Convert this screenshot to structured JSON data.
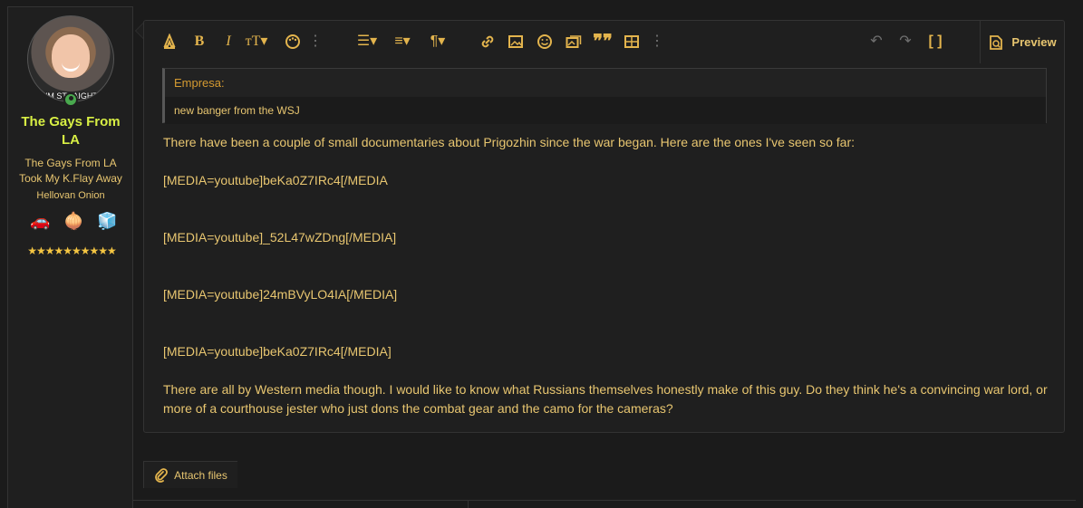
{
  "user": {
    "name": "The Gays From LA",
    "title": "The Gays From LA Took My K.Flay Away",
    "role": "Hellovan Onion",
    "avatar_caption": "I'M STRAIGHT",
    "trophies": [
      "onion-car-icon",
      "onion-icon",
      "cube-icon"
    ],
    "stars": "★★★★★★★★★★"
  },
  "editor": {
    "toolbar": {
      "items": [
        "format-icon",
        "bold-icon",
        "italic-icon",
        "text-size-icon",
        "palette-icon",
        "more-icon",
        "list-icon",
        "align-icon",
        "paragraph-icon",
        "link-icon",
        "image-icon",
        "smilie-icon",
        "media-icon",
        "quote-icon",
        "table-icon",
        "more-icon",
        "undo-icon",
        "redo-icon",
        "fullscreen-icon"
      ],
      "preview_label": "Preview"
    },
    "quote": {
      "author": "Empresa:",
      "text": "new banger from the WSJ"
    },
    "body": [
      "There have been a couple of small documentaries about Prigozhin since the war began. Here are the ones I've seen so far:",
      "[MEDIA=youtube]beKa0Z7IRc4[/MEDIA",
      "[MEDIA=youtube]_52L47wZDng[/MEDIA]",
      "[MEDIA=youtube]24mBVyLO4IA[/MEDIA]",
      "[MEDIA=youtube]beKa0Z7IRc4[/MEDIA]",
      "There are all by Western media though. I would like to know what Russians themselves honestly make of this guy. Do they think he's a convincing war lord, or more of a courthouse jester who just dons the combat gear and the camo for the cameras?"
    ]
  },
  "attach_label": "Attach files",
  "colors": {
    "background": "#1b1b1b",
    "panel": "#1f1f1f",
    "text": "#e8c670",
    "accent": "#e3b44d",
    "username": "#d8ef44"
  }
}
